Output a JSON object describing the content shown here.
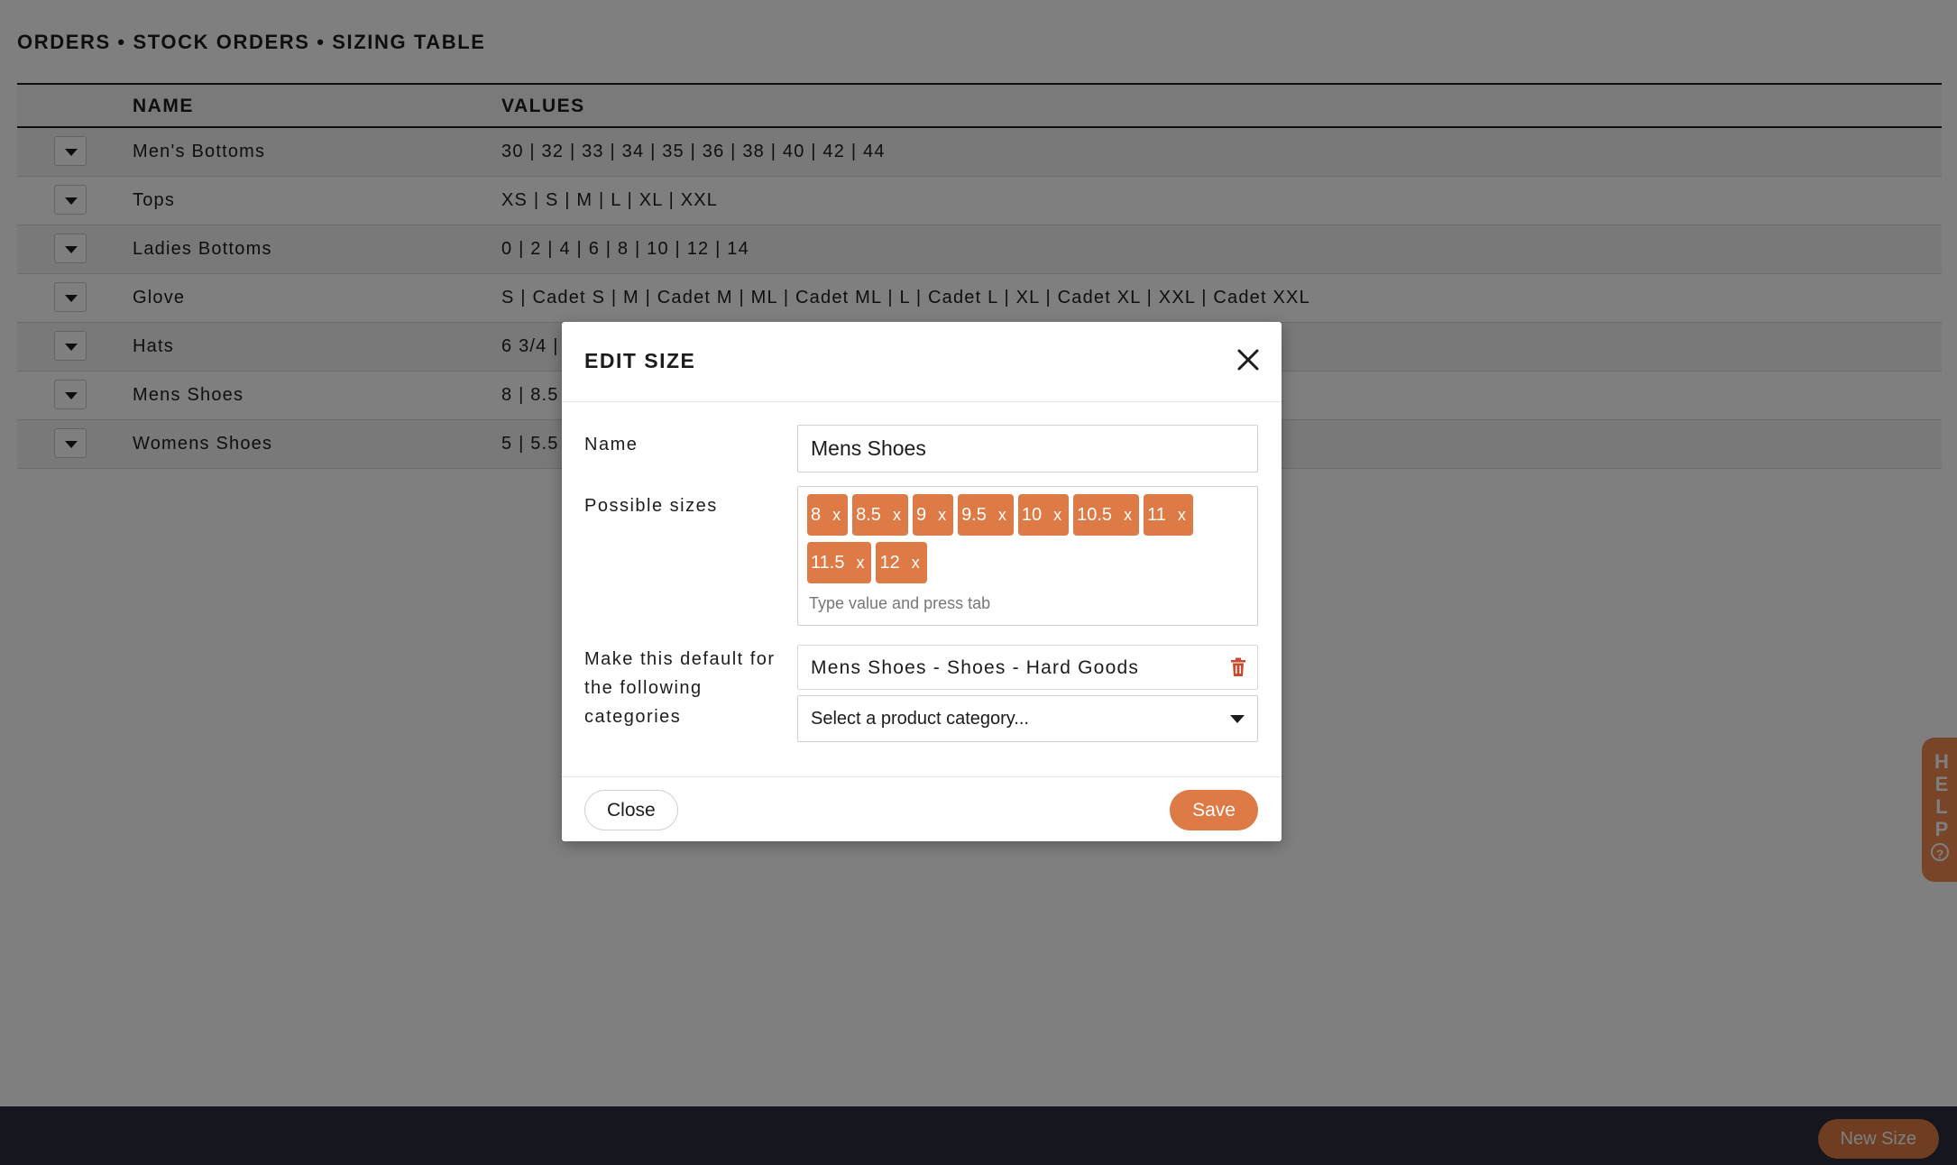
{
  "breadcrumb": "ORDERS • STOCK ORDERS • SIZING TABLE",
  "table": {
    "headers": {
      "name": "NAME",
      "values": "VALUES"
    },
    "rows": [
      {
        "name": "Men's Bottoms",
        "values": "30 | 32 | 33 | 34 | 35 | 36 | 38 | 40 | 42 | 44"
      },
      {
        "name": "Tops",
        "values": "XS | S | M | L | XL | XXL"
      },
      {
        "name": "Ladies Bottoms",
        "values": "0 | 2 | 4 | 6 | 8 | 10 | 12 | 14"
      },
      {
        "name": "Glove",
        "values": "S | Cadet S | M | Cadet M | ML | Cadet ML | L | Cadet L | XL | Cadet XL | XXL | Cadet XXL"
      },
      {
        "name": "Hats",
        "values": "6 3/4 |"
      },
      {
        "name": "Mens Shoes",
        "values": "8 | 8.5"
      },
      {
        "name": "Womens Shoes",
        "values": "5 | 5.5"
      }
    ]
  },
  "footer": {
    "new_size_label": "New Size"
  },
  "help_tab": {
    "label": "HELP",
    "icon": "question-circle-icon"
  },
  "modal": {
    "title": "EDIT SIZE",
    "name_label": "Name",
    "name_value": "Mens Shoes",
    "sizes_label": "Possible sizes",
    "sizes": [
      {
        "value": "8",
        "remove": "x"
      },
      {
        "value": "8.5",
        "remove": "x"
      },
      {
        "value": "9",
        "remove": "x"
      },
      {
        "value": "9.5",
        "remove": "x"
      },
      {
        "value": "10",
        "remove": "x"
      },
      {
        "value": "10.5",
        "remove": "x"
      },
      {
        "value": "11",
        "remove": "x"
      },
      {
        "value": "11.5",
        "remove": "x"
      },
      {
        "value": "12",
        "remove": "x"
      }
    ],
    "sizes_placeholder": "Type value and press tab",
    "default_label": "Make this default for the following categories",
    "default_category": "Mens Shoes - Shoes - Hard Goods",
    "category_select_placeholder": "Select a product category...",
    "close_label": "Close",
    "save_label": "Save"
  },
  "colors": {
    "accent": "#de7a45",
    "footer_bg": "#2d2c3d",
    "help_bg": "#f08a50",
    "trash": "#c94a2f"
  }
}
